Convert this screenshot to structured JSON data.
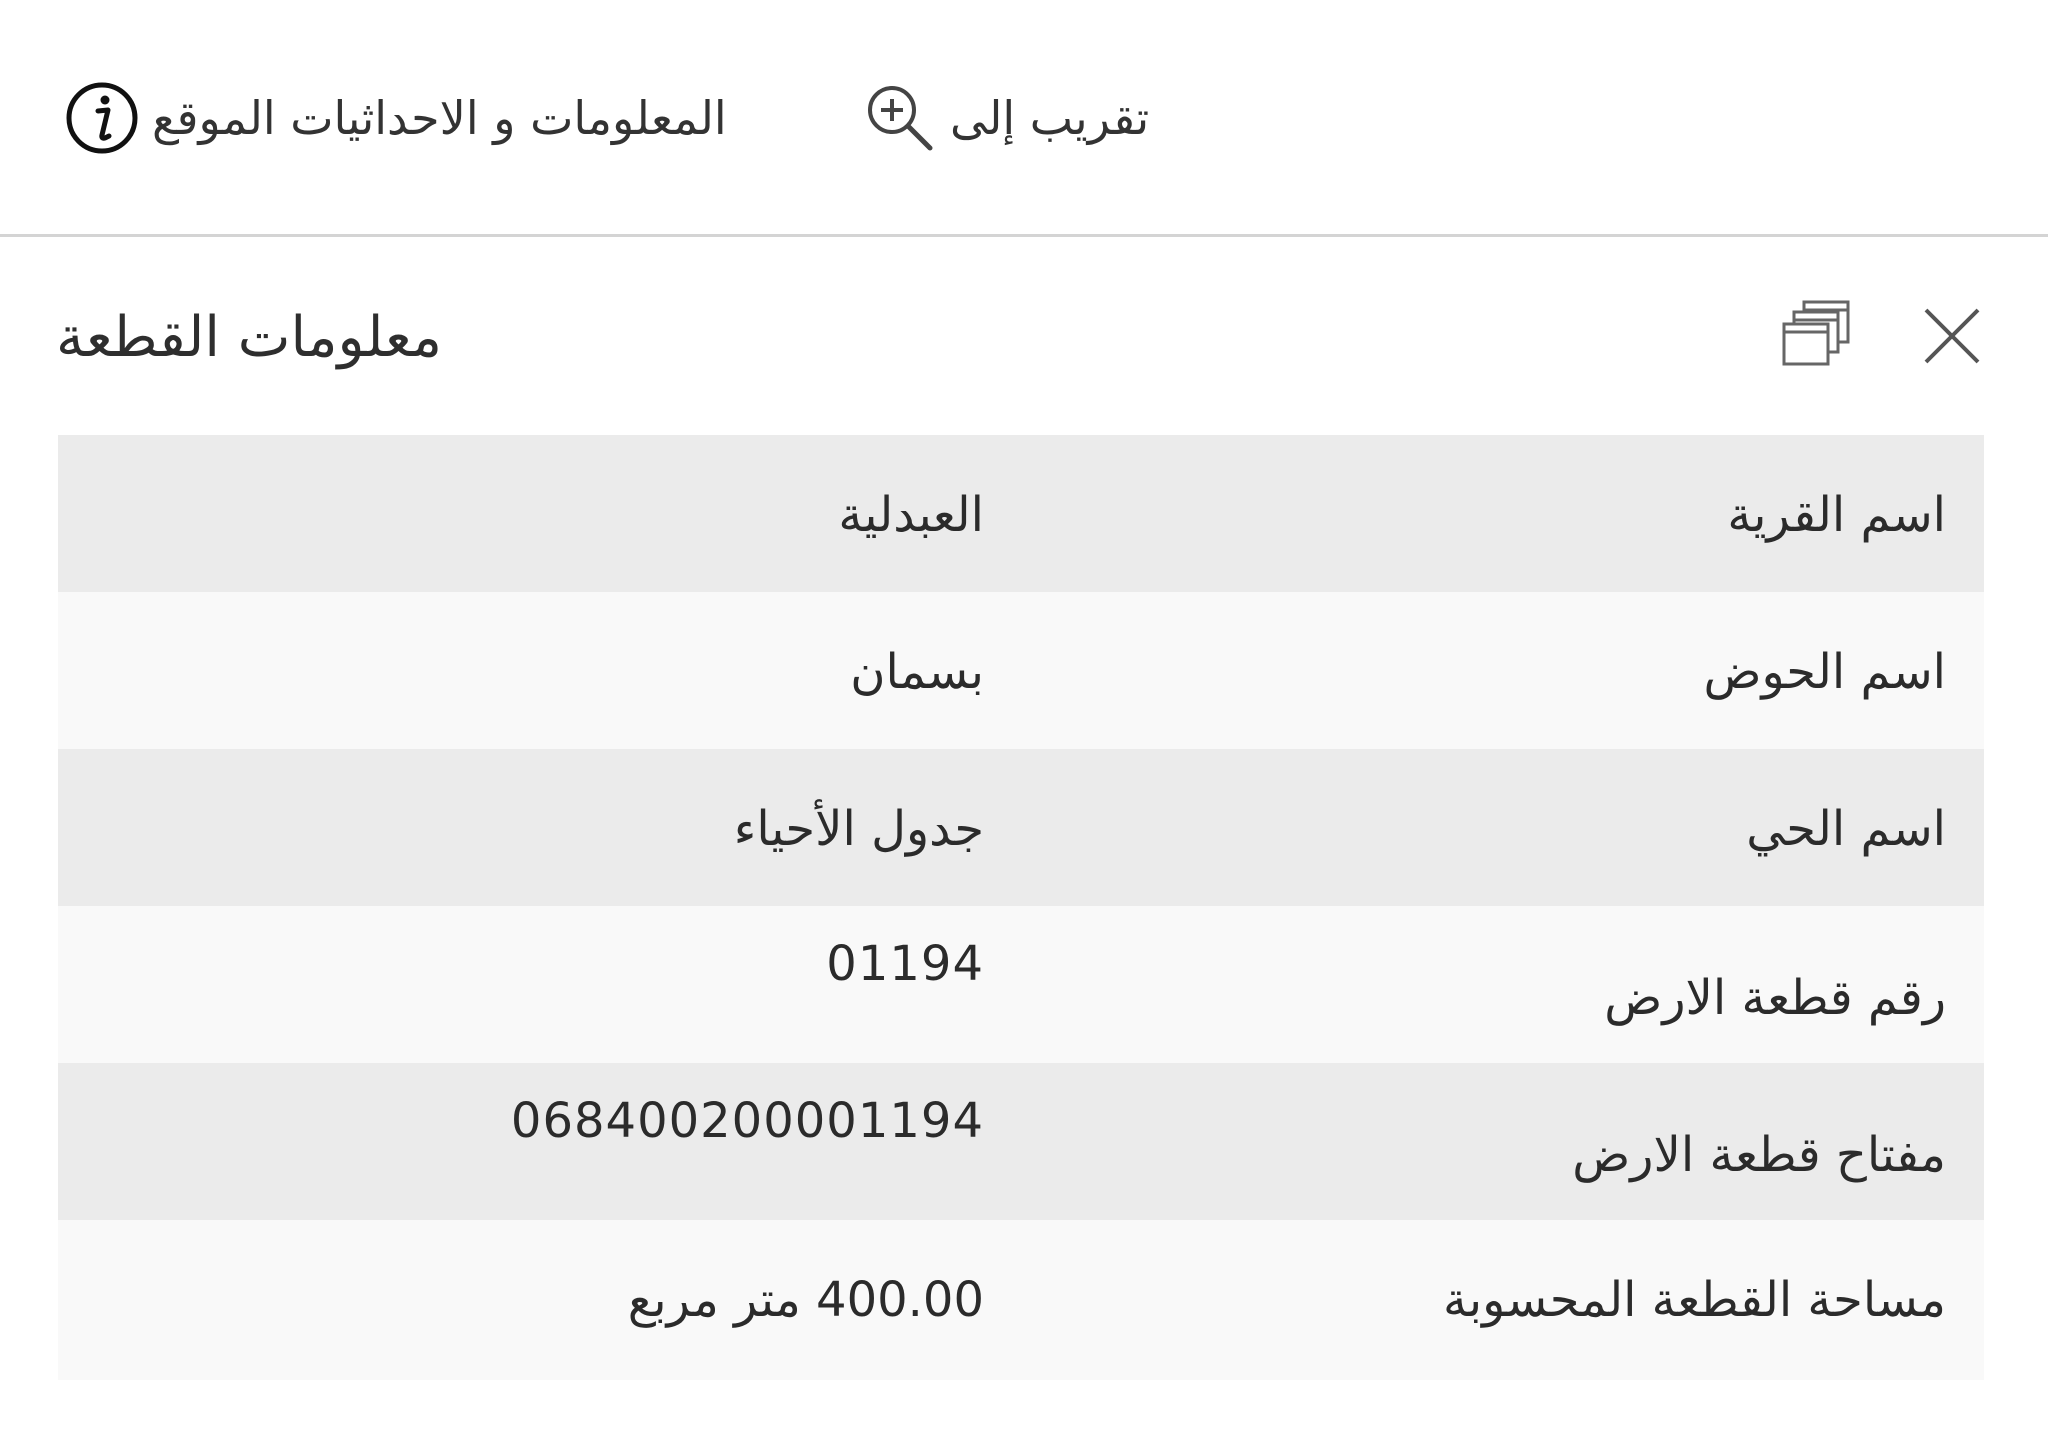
{
  "toolbar": {
    "info_label": "المعلومات و الاحداثيات الموقع",
    "info_icon": "info-circle-icon",
    "zoom_label": "تقريب إلى",
    "zoom_icon": "zoom-in-icon"
  },
  "panel": {
    "title": "معلومات القطعة",
    "copy_icon": "copy-icon",
    "close_icon": "close-icon"
  },
  "rows": [
    {
      "label": "اسم القرية",
      "value": "العبدلية"
    },
    {
      "label": "اسم الحوض",
      "value": "بسمان"
    },
    {
      "label": "اسم الحي",
      "value": "جدول الأحياء"
    },
    {
      "label": "رقم قطعة الارض",
      "value": "01194"
    },
    {
      "label": "مفتاح قطعة الارض",
      "value": "068400200001194"
    },
    {
      "label": "مساحة القطعة المحسوبة",
      "value": "400.00 متر مربع"
    }
  ],
  "colors": {
    "row_shaded": "#ebebeb",
    "row_light": "#f9f9f9",
    "text": "#2b2b2b",
    "divider": "#d4d4d4"
  }
}
